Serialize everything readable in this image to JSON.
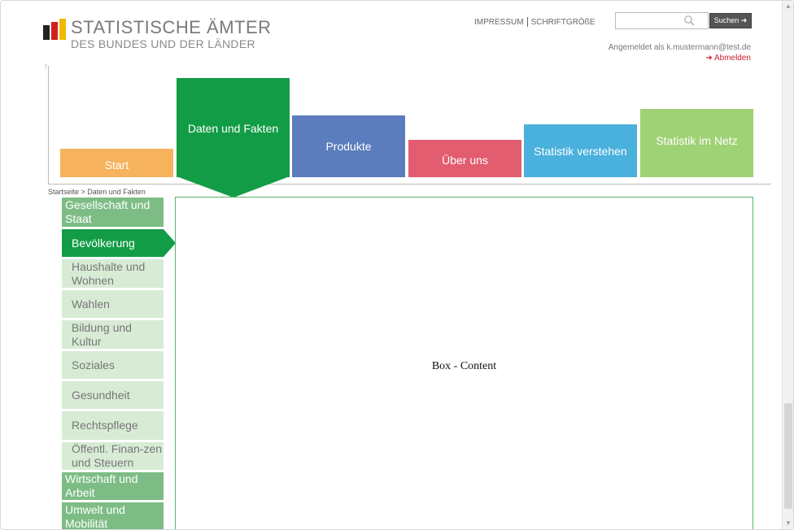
{
  "header": {
    "logo_line1": "STATISTISCHE ÄMTER",
    "logo_line2": "DES BUNDES UND DER LÄNDER",
    "link_impressum": "IMPRESSUM",
    "link_schriftgroesse": "SCHRIFTGRÖßE",
    "search_placeholder": "",
    "search_button": "Suchen ➜",
    "logged_in_text": "Angemeldet als k.mustermann@test.de",
    "logout_label": "➜ Abmelden"
  },
  "nav": {
    "start": "Start",
    "daten": "Daten und Fakten",
    "produkte": "Produkte",
    "ueber": "Über uns",
    "verstehen": "Statistik verstehen",
    "netz": "Statistik im Netz"
  },
  "breadcrumb": "Startseite > Daten und Fakten",
  "sidebar": {
    "items": [
      {
        "label": "Gesellschaft und Staat",
        "kind": "category"
      },
      {
        "label": "Bevölkerung",
        "kind": "active"
      },
      {
        "label": "Haushalte und Wohnen",
        "kind": "sub"
      },
      {
        "label": "Wahlen",
        "kind": "sub"
      },
      {
        "label": "Bildung und Kultur",
        "kind": "sub"
      },
      {
        "label": "Soziales",
        "kind": "sub"
      },
      {
        "label": "Gesundheit",
        "kind": "sub"
      },
      {
        "label": "Rechtspflege",
        "kind": "sub"
      },
      {
        "label": "Öffentl. Finan-zen und Steuern",
        "kind": "sub"
      },
      {
        "label": "Wirtschaft und Arbeit",
        "kind": "category"
      },
      {
        "label": "Umwelt und Mobilität",
        "kind": "category"
      }
    ]
  },
  "content": {
    "text": "Box - Content"
  },
  "colors": {
    "start": "#f6b25c",
    "daten": "#139c46",
    "produkte": "#5b7cbd",
    "ueber": "#e35d70",
    "verstehen": "#4ab0dc",
    "netz": "#9fd175"
  }
}
